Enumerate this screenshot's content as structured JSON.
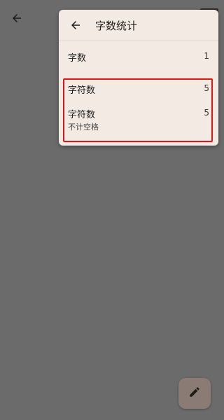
{
  "popup": {
    "title": "字数统计",
    "rows": [
      {
        "label": "字数",
        "value": "1",
        "sub": ""
      },
      {
        "label": "字符数",
        "value": "5",
        "sub": ""
      },
      {
        "label": "字符数",
        "value": "5",
        "sub": "不计空格"
      }
    ]
  },
  "colors": {
    "background_dim": "#6b6b6b",
    "popup_bg": "#f3ebe3",
    "highlight_border": "#e01515",
    "fab_bg": "#8a7c74"
  },
  "icons": {
    "background_back": "arrow-left",
    "popup_back": "arrow-left",
    "fab": "pencil"
  }
}
